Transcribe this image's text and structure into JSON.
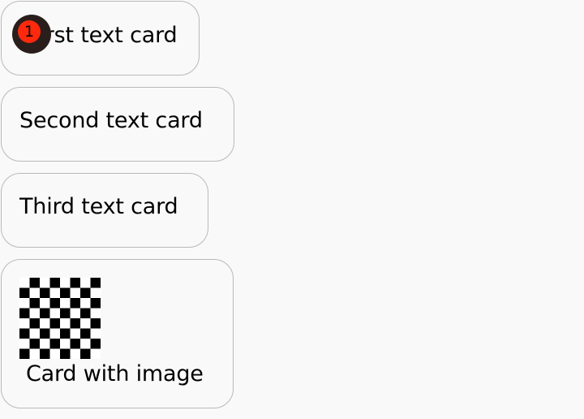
{
  "cards": [
    {
      "label": "First text card"
    },
    {
      "label": "Second text card"
    },
    {
      "label": "Third text card"
    },
    {
      "label": "Card with image",
      "image": "checkerboard-image"
    }
  ],
  "badge": {
    "count": "1",
    "color": "#ff2a0d",
    "ring_color": "#2a1e1c"
  },
  "colors": {
    "background": "#f9f9f9",
    "card_border": "#b9b9b9",
    "text": "#000000"
  }
}
